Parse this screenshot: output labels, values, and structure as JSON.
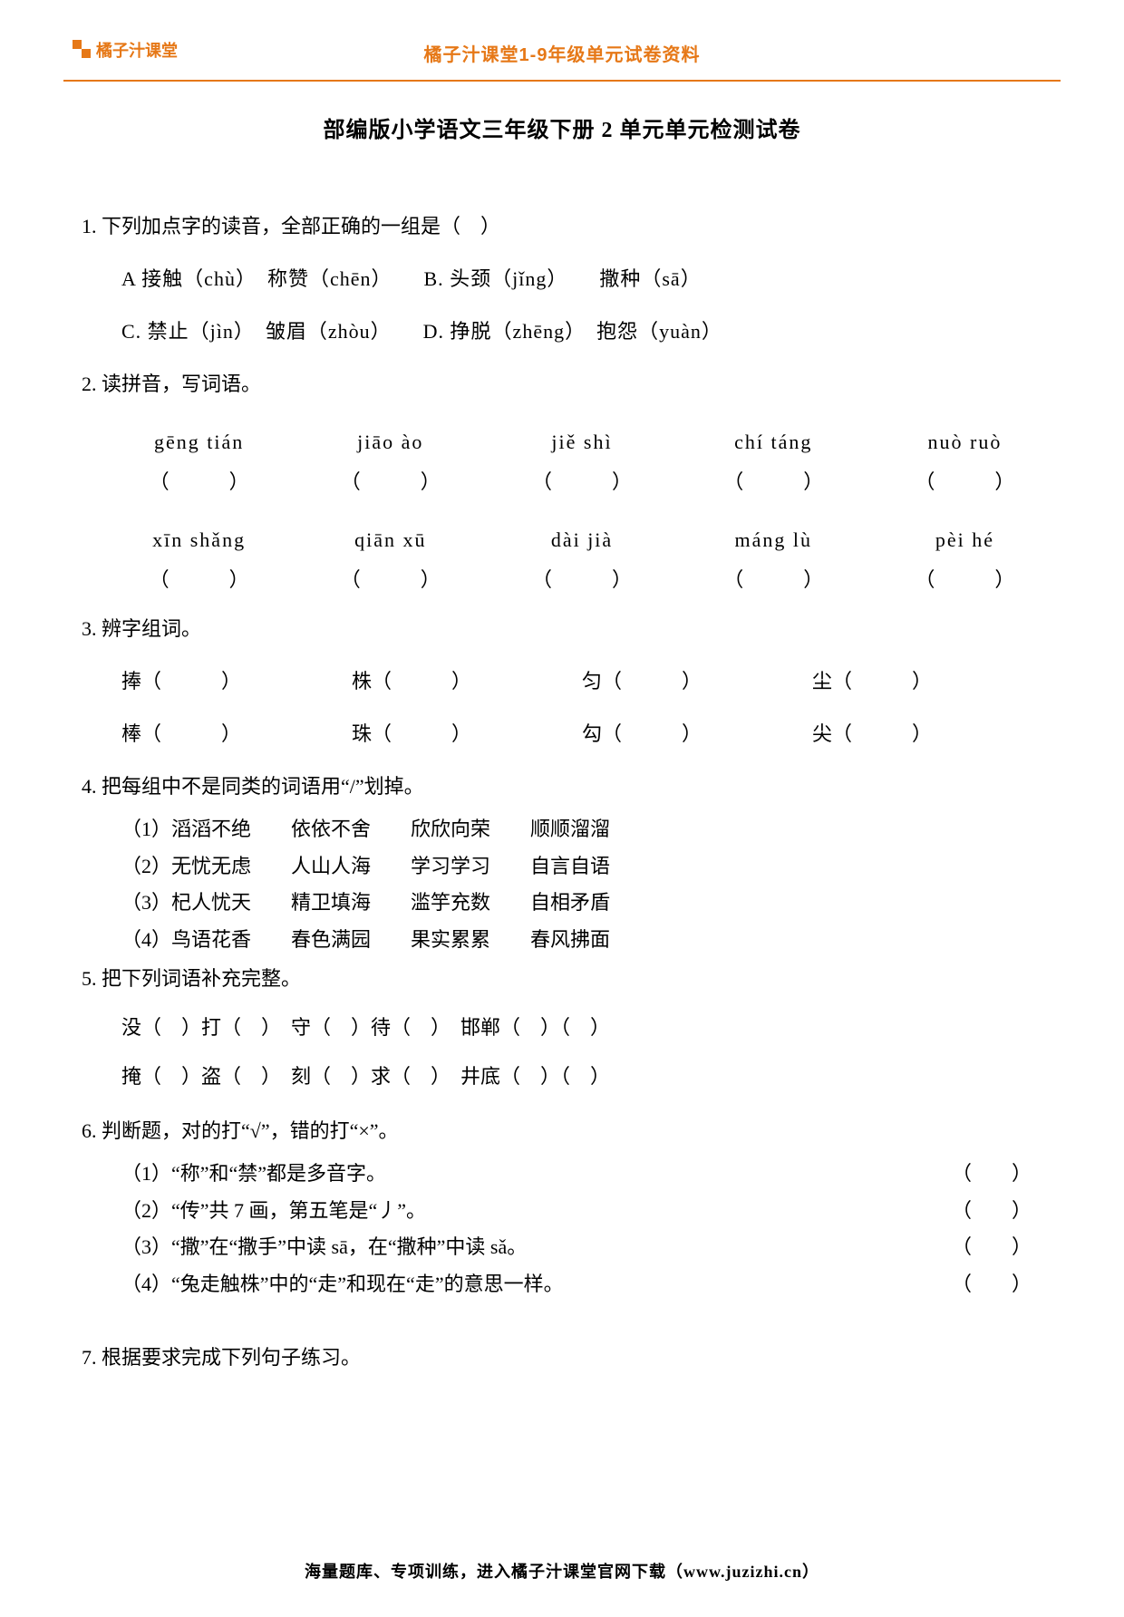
{
  "header": {
    "logo_text": "橘子汁课堂",
    "subtitle": "橘子汁课堂1-9年级单元试卷资料"
  },
  "doc_title": "部编版小学语文三年级下册 2 单元单元检测试卷",
  "q1": {
    "stem": "1. 下列加点字的读音，全部正确的一组是（　）",
    "optA": "A 接触（chù）　称赞（chēn）　　B. 头颈（jǐng）　　撒种（sā）",
    "optC": "C. 禁止（jìn）　皱眉（zhòu）　　D. 挣脱（zhēng）　抱怨（yuàn）"
  },
  "q2": {
    "stem": "2. 读拼音，写词语。",
    "row1": [
      "gēng tián",
      "jiāo ào",
      "jiě shì",
      "chí táng",
      "nuò ruò"
    ],
    "row2": [
      "xīn shǎng",
      "qiān xū",
      "dài jià",
      "máng lù",
      "pèi hé"
    ],
    "paren": "（　　　）"
  },
  "q3": {
    "stem": "3. 辨字组词。",
    "row1": [
      "捧（　　　）",
      "株（　　　）",
      "匀（　　　）",
      "尘（　　　）"
    ],
    "row2": [
      "棒（　　　）",
      "珠（　　　）",
      "勾（　　　）",
      "尖（　　　）"
    ]
  },
  "q4": {
    "stem": "4. 把每组中不是同类的词语用“/”划掉。",
    "g1": "（1）滔滔不绝　　依依不舍　　欣欣向荣　　顺顺溜溜",
    "g2": "（2）无忧无虑　　人山人海　　学习学习　　自言自语",
    "g3": "（3）杞人忧天　　精卫填海　　滥竽充数　　自相矛盾",
    "g4": "（4）鸟语花香　　春色满园　　果实累累　　春风拂面"
  },
  "q5": {
    "stem": "5. 把下列词语补充完整。",
    "line1": "没（　）打（　）　守（　）待（　）　邯郸（　）（　）",
    "line2": "掩（　）盗（　）　刻（　）求（　）　井底（　）（　）"
  },
  "q6": {
    "stem": "6. 判断题，对的打“√”，错的打“×”。",
    "items": [
      "（1）“称”和“禁”都是多音字。",
      "（2）“传”共 7 画，第五笔是“丿”。",
      "（3）“撒”在“撒手”中读 sā，在“撒种”中读 sǎ。",
      "（4）“兔走触株”中的“走”和现在“走”的意思一样。"
    ],
    "paren": "（　　）"
  },
  "q7": {
    "stem": "7. 根据要求完成下列句子练习。"
  },
  "footer": "海量题库、专项训练，进入橘子汁课堂官网下载（www.juzizhi.cn）"
}
